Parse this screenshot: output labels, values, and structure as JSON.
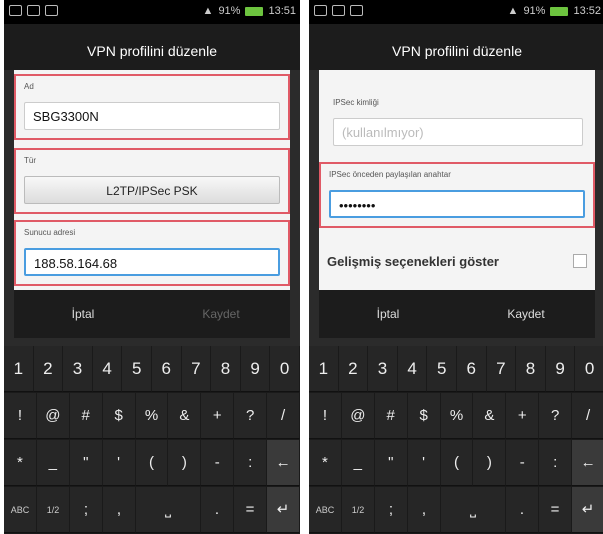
{
  "status": {
    "battery": "91%",
    "time_left": "13:51",
    "time_right": "13:52"
  },
  "dialog": {
    "title": "VPN profilini düzenle"
  },
  "left": {
    "name_label": "Ad",
    "name_value": "SBG3300N",
    "type_label": "Tür",
    "type_value": "L2TP/IPSec PSK",
    "server_label": "Sunucu adresi",
    "server_value": "188.58.164.68",
    "cancel": "İptal",
    "save": "Kaydet"
  },
  "right": {
    "ipsec_id_label": "IPSec kimliği",
    "ipsec_id_placeholder": "(kullanılmıyor)",
    "psk_label": "IPSec önceden paylaşılan anahtar",
    "psk_value": "••••••••",
    "advanced_label": "Gelişmiş seçenekleri göster",
    "cancel": "İptal",
    "save": "Kaydet"
  },
  "keyboard": {
    "row1": [
      "1",
      "2",
      "3",
      "4",
      "5",
      "6",
      "7",
      "8",
      "9",
      "0"
    ],
    "row2": [
      "!",
      "@",
      "#",
      "$",
      "%",
      "&",
      "+",
      "?",
      "/"
    ],
    "row3": [
      "*",
      "_",
      "\"",
      "'",
      "(",
      ")",
      "-",
      ":",
      "←"
    ],
    "row4": [
      "ABC",
      "1/2",
      ";",
      ",",
      "⎵",
      ".",
      "=",
      "↵"
    ]
  }
}
